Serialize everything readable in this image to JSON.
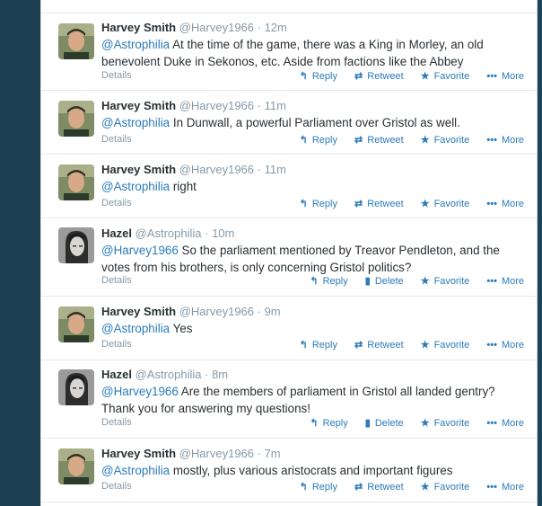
{
  "labels": {
    "details": "Details",
    "reply": "Reply",
    "retweet": "Retweet",
    "delete": "Delete",
    "favorite": "Favorite",
    "more": "More"
  },
  "icons": {
    "reply": "reply-arrow-icon",
    "retweet": "retweet-icon",
    "delete": "trash-icon",
    "favorite": "star-icon",
    "more": "ellipsis-icon"
  },
  "colors": {
    "link": "#2b7bb9",
    "muted": "#8899a6",
    "text": "#292f33",
    "background": "#1d3f52"
  },
  "tweets": [
    {
      "name": "Harvey Smith",
      "handle": "@Harvey1966",
      "time": "· 12m",
      "mention": "@Astrophilia",
      "text": " At the time of the game, there was a King in Morley, an old benevolent Duke in Sekonos, etc. Aside from factions like the Abbey"
    },
    {
      "name": "Harvey Smith",
      "handle": "@Harvey1966",
      "time": "· 11m",
      "mention": "@Astrophilia",
      "text": " In Dunwall, a powerful Parliament over Gristol as well."
    },
    {
      "name": "Harvey Smith",
      "handle": "@Harvey1966",
      "time": "· 11m",
      "mention": "@Astrophilia",
      "text": " right"
    },
    {
      "name": "Hazel",
      "handle": "@Astrophilia",
      "time": "· 10m",
      "mention": "@Harvey1966",
      "text": " So the parliament mentioned by Treavor Pendleton, and the votes from his brothers, is only concerning Gristol politics?"
    },
    {
      "name": "Harvey Smith",
      "handle": "@Harvey1966",
      "time": "· 9m",
      "mention": "@Astrophilia",
      "text": " Yes"
    },
    {
      "name": "Hazel",
      "handle": "@Astrophilia",
      "time": "· 8m",
      "mention": "@Harvey1966",
      "text": " Are the members of parliament in Gristol all landed gentry? Thank you for answering my questions!"
    },
    {
      "name": "Harvey Smith",
      "handle": "@Harvey1966",
      "time": "· 7m",
      "mention": "@Astrophilia",
      "text": " mostly, plus various aristocrats and important figures"
    }
  ]
}
